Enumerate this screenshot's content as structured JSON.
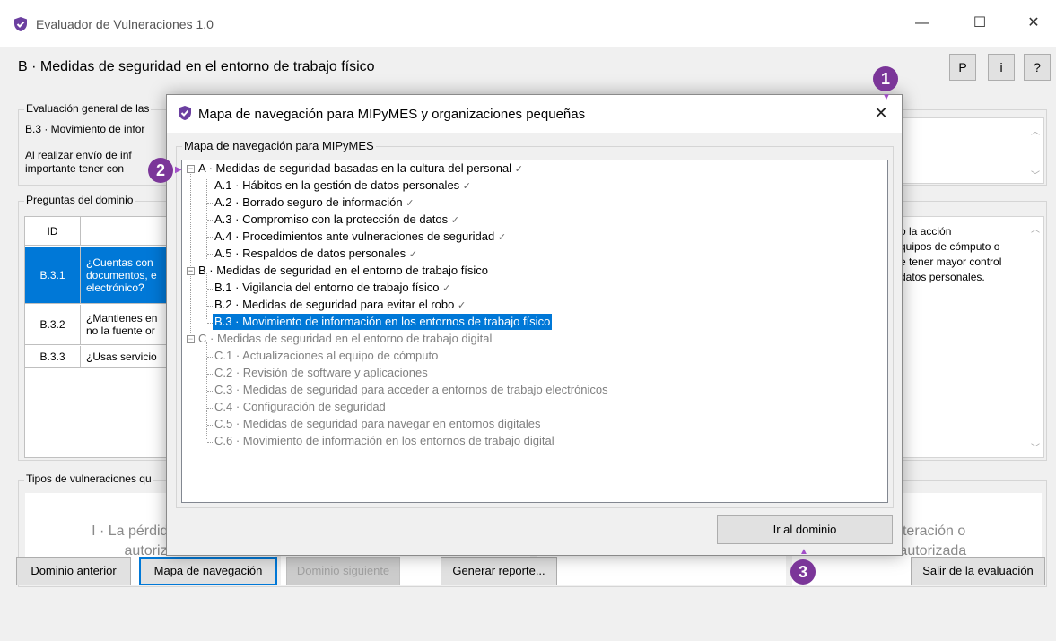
{
  "colors": {
    "accent": "#0078d7",
    "callout": "#7b3699",
    "shield": "#6b3fa0"
  },
  "window": {
    "title": "Evaluador de Vulneraciones 1.0",
    "icon": "shield-check-icon",
    "controls": {
      "minimize": "—",
      "maximize": "☐",
      "close": "✕"
    }
  },
  "header": {
    "title": "B · Medidas de seguridad en el entorno de trabajo físico",
    "buttons": [
      "P",
      "i",
      "?"
    ]
  },
  "evaluacion": {
    "legend": "Evaluación general de las",
    "line1": "B.3 · Movimiento de infor",
    "line2": "Al realizar envío de inf",
    "line3": "importante tener con"
  },
  "preguntas": {
    "legend": "Preguntas del dominio",
    "id_header": "ID",
    "rows": [
      {
        "id": "B.3.1",
        "text": "¿Cuentas con\ndocumentos, e\nelectrónico?",
        "selected": true
      },
      {
        "id": "B.3.2",
        "text": "¿Mantienes en\nno la fuente or",
        "selected": false
      },
      {
        "id": "B.3.3",
        "text": "¿Usas servicio",
        "selected": false
      }
    ],
    "detail_text": "o la acción\nquipos de cómputo o\ne tener mayor control\ndatos personales."
  },
  "tipos": {
    "legend": "Tipos de vulneraciones qu",
    "card1_line1": "I · La pérdida o de",
    "card1_line2": "autoriza",
    "card4_line1": ", la alteración o",
    "card4_line2": "n no autorizada"
  },
  "bottom_buttons": {
    "anterior": "Dominio anterior",
    "mapa": "Mapa de navegación",
    "siguiente": "Dominio siguiente",
    "reporte": "Generar reporte...",
    "salir": "Salir de la evaluación"
  },
  "dialog": {
    "title": "Mapa de navegación para MIPyMES y organizaciones pequeñas",
    "close": "✕",
    "group_label": "Mapa de navegación para MIPyMES",
    "go_button": "Ir al dominio",
    "check": "✓",
    "expand_symbol": "−",
    "tree": {
      "a": {
        "label": "A · Medidas de seguridad basadas en la cultura del personal",
        "done": true
      },
      "a1": {
        "label": "A.1 · Hábitos en la gestión de datos personales",
        "done": true
      },
      "a2": {
        "label": "A.2 · Borrado seguro de información",
        "done": true
      },
      "a3": {
        "label": "A.3 · Compromiso con la protección de datos",
        "done": true
      },
      "a4": {
        "label": "A.4 · Procedimientos ante vulneraciones de seguridad",
        "done": true
      },
      "a5": {
        "label": "A.5 · Respaldos de datos personales",
        "done": true
      },
      "b": {
        "label": "B · Medidas de seguridad en el entorno de trabajo físico"
      },
      "b1": {
        "label": "B.1 · Vigilancia del entorno de trabajo físico",
        "done": true
      },
      "b2": {
        "label": "B.2 · Medidas de seguridad para evitar el robo",
        "done": true
      },
      "b3": {
        "label": "B.3 · Movimiento de información en los entornos de trabajo físico",
        "selected": true
      },
      "c": {
        "label": "C · Medidas de seguridad en el entorno de trabajo digital",
        "disabled": true
      },
      "c1": {
        "label": "C.1 · Actualizaciones al equipo de cómputo",
        "disabled": true
      },
      "c2": {
        "label": "C.2 · Revisión de software y aplicaciones",
        "disabled": true
      },
      "c3": {
        "label": "C.3 · Medidas de seguridad para acceder a entornos de trabajo electrónicos",
        "disabled": true
      },
      "c4": {
        "label": "C.4 · Configuración de seguridad",
        "disabled": true
      },
      "c5": {
        "label": "C.5 · Medidas de seguridad para navegar en entornos digitales",
        "disabled": true
      },
      "c6": {
        "label": "C.6 · Movimiento de información en los entornos de trabajo digital",
        "disabled": true
      }
    }
  },
  "callouts": [
    "1",
    "2",
    "3"
  ]
}
